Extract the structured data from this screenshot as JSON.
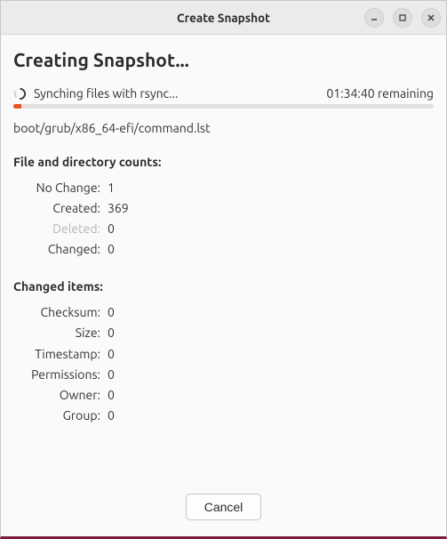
{
  "window": {
    "title": "Create Snapshot"
  },
  "heading": "Creating Snapshot...",
  "status": {
    "message": "Synching files with rsync...",
    "remaining": "01:34:40 remaining"
  },
  "current_file": "boot/grub/x86_64-efi/command.lst",
  "counts": {
    "title": "File and directory counts:",
    "rows": [
      {
        "label": "No Change:",
        "value": "1",
        "disabled": false
      },
      {
        "label": "Created:",
        "value": "369",
        "disabled": false
      },
      {
        "label": "Deleted:",
        "value": "0",
        "disabled": true
      },
      {
        "label": "Changed:",
        "value": "0",
        "disabled": false
      }
    ]
  },
  "changed": {
    "title": "Changed items:",
    "rows": [
      {
        "label": "Checksum:",
        "value": "0"
      },
      {
        "label": "Size:",
        "value": "0"
      },
      {
        "label": "Timestamp:",
        "value": "0"
      },
      {
        "label": "Permissions:",
        "value": "0"
      },
      {
        "label": "Owner:",
        "value": "0"
      },
      {
        "label": "Group:",
        "value": "0"
      }
    ]
  },
  "footer": {
    "cancel": "Cancel"
  }
}
